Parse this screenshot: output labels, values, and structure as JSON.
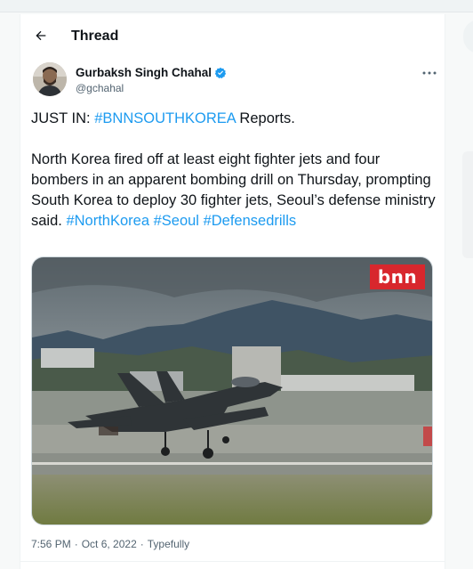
{
  "header": {
    "title": "Thread"
  },
  "author": {
    "display_name": "Gurbaksh Singh Chahal",
    "handle": "@gchahal"
  },
  "tweet": {
    "line1_prefix": "JUST IN: ",
    "line1_tag": "#BNNSOUTHKOREA",
    "line1_suffix": " Reports.",
    "body": "North Korea fired off at least eight fighter jets and four bombers in an apparent bombing drill on Thursday, prompting South Korea to deploy 30 fighter jets, Seoul’s defense ministry said. ",
    "tags": [
      "#NorthKorea",
      "#Seoul",
      "#Defensedrills"
    ]
  },
  "media": {
    "logo_text": "bnn"
  },
  "meta": {
    "time": "7:56 PM",
    "sep": "·",
    "date": "Oct 6, 2022",
    "sep2": "·",
    "source": "Typefully"
  },
  "colors": {
    "link": "#1d9bf0",
    "verified": "#1d9bf0",
    "logo_bg": "#d8272d"
  },
  "icons": {
    "back": "arrow-left-icon",
    "verified": "verified-badge-icon",
    "more": "more-dots-icon"
  }
}
